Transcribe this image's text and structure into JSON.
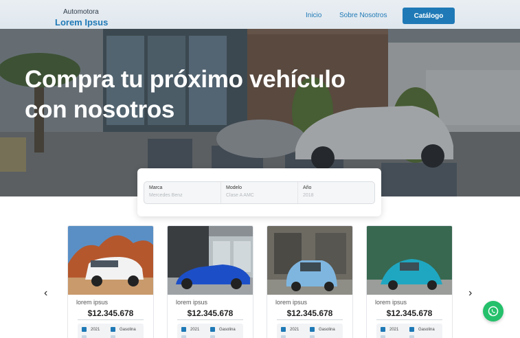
{
  "header": {
    "brand_top": "Automotora",
    "brand_bottom": "Lorem Ipsus",
    "nav_inicio": "Inicio",
    "nav_sobre": "Sobre Nosotros",
    "catalog_button": "Catálogo"
  },
  "hero": {
    "title": "Compra tu próximo vehículo con nosotros"
  },
  "search": {
    "brand_label": "Marca",
    "brand_placeholder": "Mercedes Benz",
    "model_label": "Modelo",
    "model_placeholder": "Clase A AMC",
    "year_label": "Año",
    "year_placeholder": "2018"
  },
  "cards": [
    {
      "name": "lorem ipsus",
      "price": "$12.345.678",
      "year": "2021",
      "fuel": "Gasolina"
    },
    {
      "name": "lorem ipsus",
      "price": "$12.345.678",
      "year": "2021",
      "fuel": "Gasolina"
    },
    {
      "name": "lorem ipsus",
      "price": "$12.345.678",
      "year": "2021",
      "fuel": "Gasolina"
    },
    {
      "name": "lorem ipsus",
      "price": "$12.345.678",
      "year": "2021",
      "fuel": "Gasolina"
    }
  ],
  "carousel": {
    "prev_icon": "chevron-left-icon",
    "next_icon": "chevron-right-icon",
    "prev_glyph": "‹",
    "next_glyph": "›"
  },
  "whatsapp": {
    "icon": "whatsapp-icon"
  },
  "colors": {
    "brand_blue": "#1f79b6",
    "whatsapp_green": "#25c06b"
  }
}
